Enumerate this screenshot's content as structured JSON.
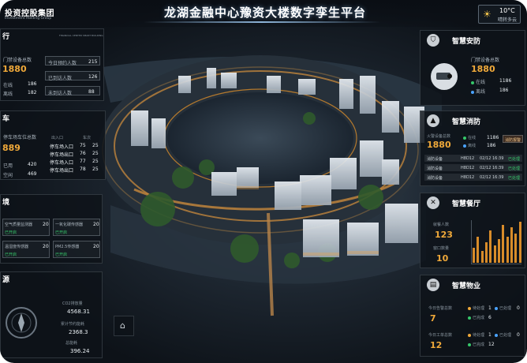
{
  "header": {
    "company": "投资控股集团",
    "company_sub": "Investment Holding Group",
    "title": "龙湖金融中心豫资大楼数字孪生平台"
  },
  "weather": {
    "temp": "10°C",
    "desc": "晴转多云"
  },
  "left_top": {
    "title": "行",
    "header_tag": "FINANCIAL CENTER SMART BUILDING",
    "total_label": "门禁设备总数",
    "total": "1880",
    "m1_label": "在线",
    "m1": "186",
    "m2_label": "离线",
    "m2": "182",
    "rows": [
      {
        "label": "今日预约人数",
        "value": "215"
      },
      {
        "label": "已到访人数",
        "value": "126"
      },
      {
        "label": "未到访人数",
        "value": "88"
      }
    ]
  },
  "left_mid": {
    "title": "车",
    "total_label": "停车场车位总数",
    "total": "889",
    "a_label": "已用",
    "a": "420",
    "b_label": "空闲",
    "b": "469",
    "cols": [
      "出入口",
      "车次"
    ],
    "table": [
      {
        "name": "停车场入口",
        "v1": "75",
        "v2": "25"
      },
      {
        "name": "停车场出口",
        "v1": "76",
        "v2": "25"
      },
      {
        "name": "停车场入口",
        "v1": "77",
        "v2": "25"
      },
      {
        "name": "停车场出口",
        "v1": "78",
        "v2": "25"
      }
    ]
  },
  "left_low": {
    "title": "境",
    "items": [
      {
        "label": "空气质量监测器",
        "value": "20",
        "status": "已开启"
      },
      {
        "label": "一氧化碳传感器",
        "value": "20",
        "status": "已开启"
      },
      {
        "label": "温湿度传感器",
        "value": "20",
        "status": "已开启"
      },
      {
        "label": "PM2.5传感器",
        "value": "20",
        "status": "已开启"
      }
    ]
  },
  "left_bottom": {
    "title": "源",
    "e1_label": "CO2排放量",
    "e1": "4568.31",
    "e2_label": "累计节约能耗",
    "e2": "2368.3",
    "e3_label": "总能耗",
    "e3": "396.24"
  },
  "security": {
    "title": "智慧安防",
    "sub": "门禁设备总数",
    "total": "1880",
    "online_label": "在线",
    "online": "1186",
    "offline_label": "离线",
    "offline": "186"
  },
  "fire": {
    "title": "智慧消防",
    "sub": "火警设备总数",
    "total": "1880",
    "online_label": "在线",
    "online": "1186",
    "offline_label": "离线",
    "offline": "186",
    "tag": "消防报警",
    "rows": [
      {
        "c1": "消防设备",
        "c2": "H8D12",
        "c3": "02/12 16:39",
        "c4": "已处理"
      },
      {
        "c1": "消防设备",
        "c2": "H8D12",
        "c3": "02/12 16:39",
        "c4": "已处理"
      },
      {
        "c1": "消防设备",
        "c2": "H8D12",
        "c3": "02/12 16:39",
        "c4": "已处理"
      }
    ]
  },
  "dining": {
    "title": "智慧餐厅",
    "a_label": "就餐人数",
    "a": "123",
    "b_label": "窗口数量",
    "b": "10",
    "bar_values": [
      5,
      9,
      4,
      7,
      11,
      6,
      8,
      13,
      9,
      12,
      10,
      14
    ]
  },
  "property": {
    "title": "智慧物业",
    "a_label": "今日告警总数",
    "a": "7",
    "b_label": "今日工单总数",
    "b": "12",
    "r1": [
      {
        "k": "待处理",
        "v": "1"
      },
      {
        "k": "已处理",
        "v": "0"
      },
      {
        "k": "已完成",
        "v": "6"
      }
    ],
    "r2": [
      {
        "k": "待处理",
        "v": "1"
      },
      {
        "k": "已处理",
        "v": "0"
      },
      {
        "k": "已完成",
        "v": "12"
      }
    ]
  },
  "colors": {
    "accent": "#f0a93a",
    "online": "#36c76a",
    "offline": "#4aa3ff"
  }
}
